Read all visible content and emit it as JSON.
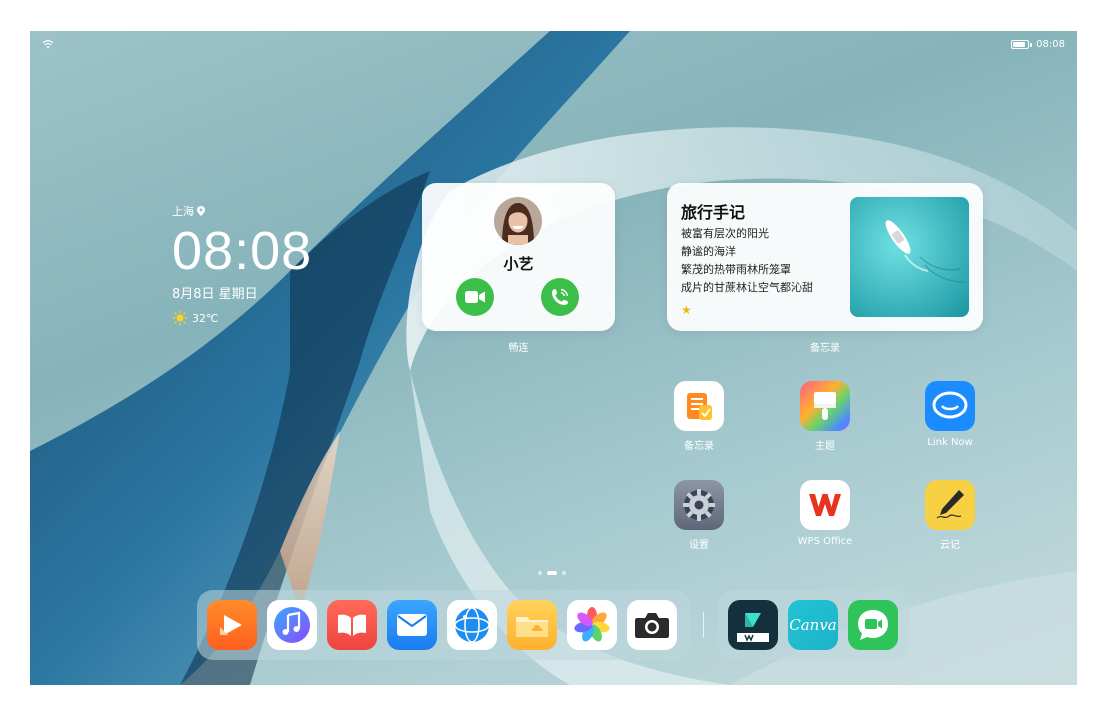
{
  "status_bar": {
    "time": "08:08"
  },
  "clock": {
    "city": "上海",
    "time": "08:08",
    "date": "8月8日 星期日",
    "temperature": "32℃"
  },
  "contact_widget": {
    "name": "小艺",
    "label": "畅连"
  },
  "memo_widget": {
    "title": "旅行手记",
    "lines": [
      "被富有层次的阳光",
      "静谧的海洋",
      "繁茂的热带雨林所笼罩",
      "成片的甘蔗林让空气都沁甜"
    ],
    "label": "备忘录"
  },
  "apps": [
    {
      "label": "备忘录"
    },
    {
      "label": "主题"
    },
    {
      "label": "Link Now"
    },
    {
      "label": "设置"
    },
    {
      "label": "WPS Office"
    },
    {
      "label": "云记"
    }
  ],
  "dock": {
    "icons": [
      "video-icon",
      "music-icon",
      "books-icon",
      "mail-icon",
      "browser-icon",
      "files-icon",
      "gallery-icon",
      "camera-icon"
    ],
    "recent": [
      "filmora-icon",
      "canva-icon",
      "meetime-icon"
    ],
    "canva_text": "Canva"
  },
  "pager": {
    "pages": 3,
    "active": 1
  },
  "colors": {
    "call_green": "#3cbf4a",
    "accent_blue": "#1a8cff"
  }
}
